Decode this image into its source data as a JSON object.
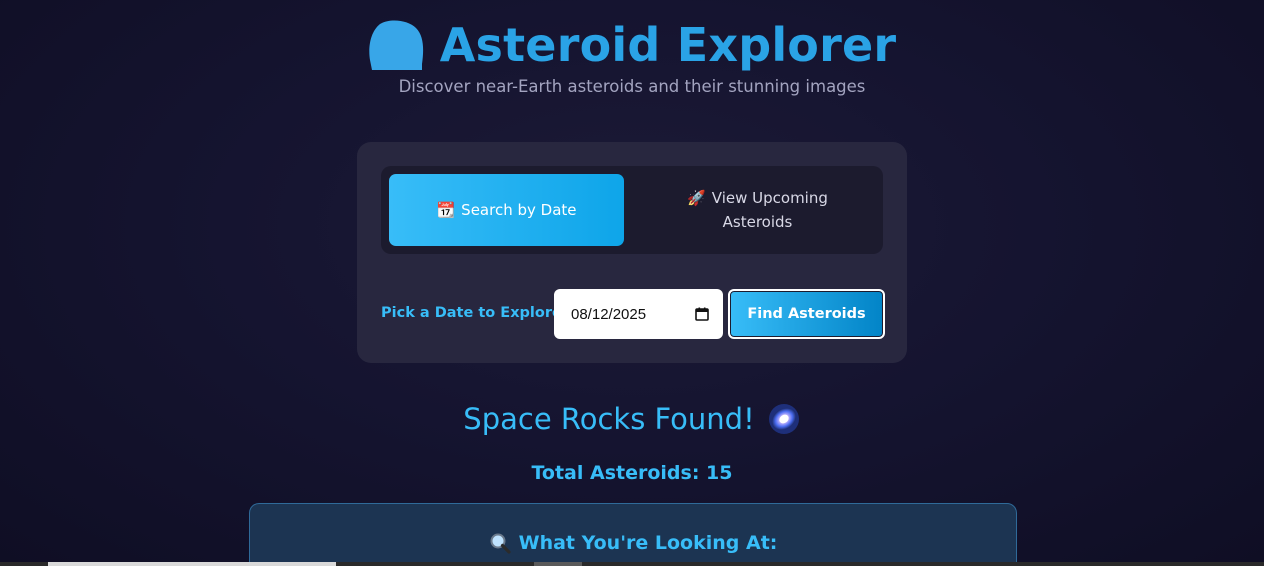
{
  "header": {
    "logo_icon": "asteroid-icon",
    "title": "Asteroid Explorer",
    "subtitle": "Discover near-Earth asteroids and their stunning images"
  },
  "tabs": [
    {
      "icon": "calendar-emoji",
      "emoji": "📆",
      "label": "Search by Date",
      "active": true
    },
    {
      "icon": "rocket-emoji",
      "emoji": "🚀",
      "label": "View Upcoming Asteroids",
      "active": false
    }
  ],
  "search": {
    "label": "Pick a Date to Explore:",
    "date_value": "08/12/2025",
    "button_label": "Find Asteroids"
  },
  "results": {
    "title": "Space Rocks Found!",
    "title_icon": "galaxy-icon",
    "total_label": "Total Asteroids: 15"
  },
  "info": {
    "icon": "magnifier-icon",
    "title": "What You're Looking At:"
  },
  "colors": {
    "accent": "#38bdf8",
    "title": "#2aa3e6",
    "panel": "#28273f",
    "background": "#151430"
  }
}
